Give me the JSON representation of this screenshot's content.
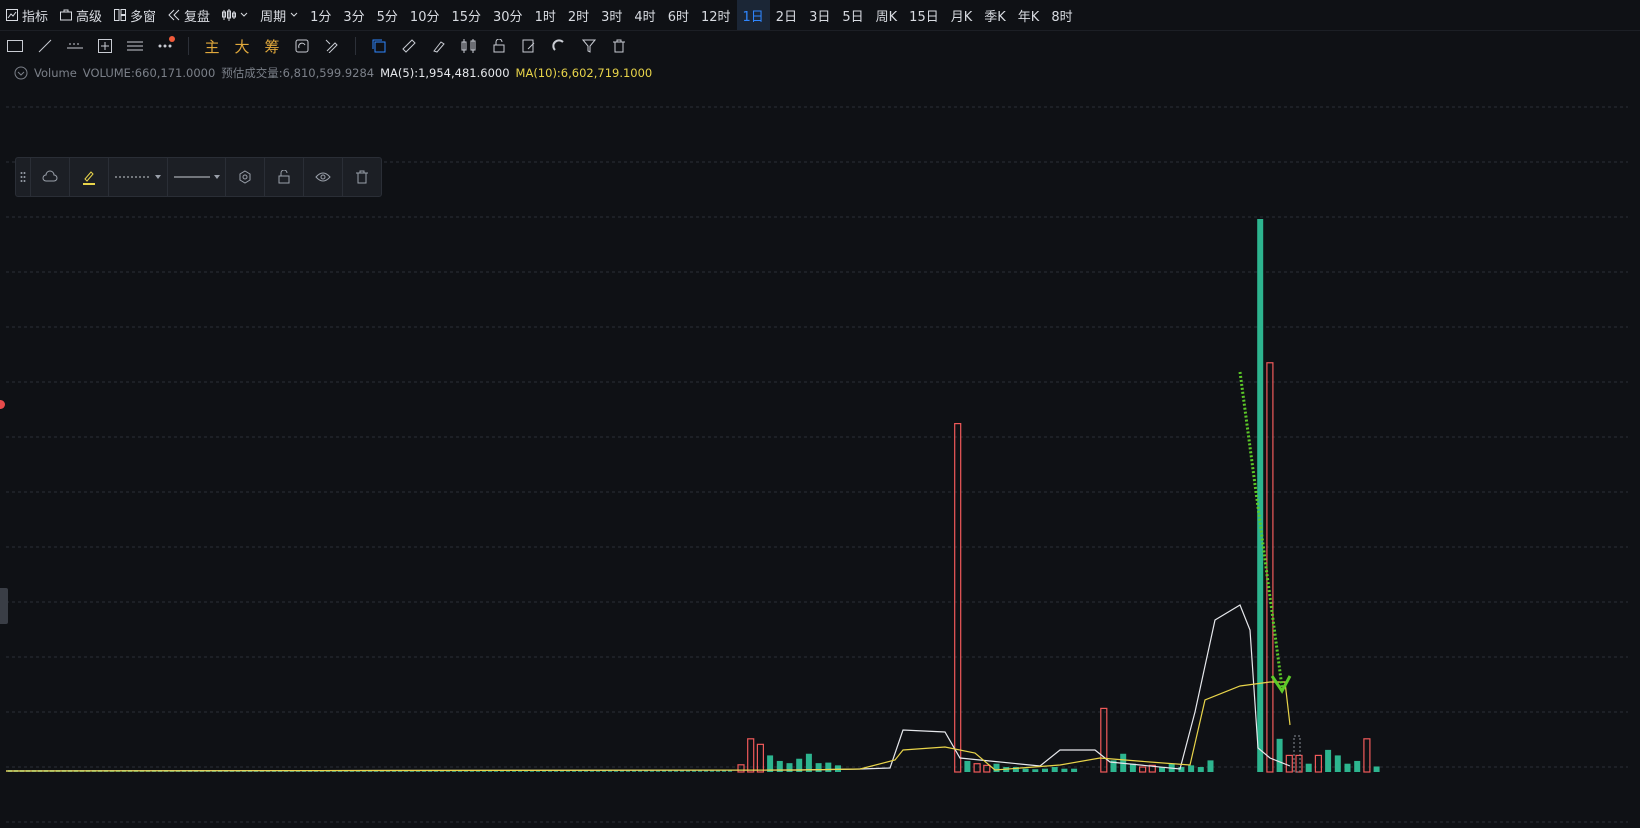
{
  "topbar": {
    "items": [
      "指标",
      "高级",
      "多窗",
      "复盘",
      "",
      "周期"
    ],
    "periods": [
      "1分",
      "3分",
      "5分",
      "10分",
      "15分",
      "30分",
      "1时",
      "2时",
      "3时",
      "4时",
      "6时",
      "12时",
      "1日",
      "2日",
      "3日",
      "5日",
      "周K",
      "15日",
      "月K",
      "季K",
      "年K",
      "8时"
    ],
    "active_period": "1日"
  },
  "toolbar": {
    "indicator_buttons": [
      "主",
      "大",
      "筹"
    ],
    "accent": "#e0a83c",
    "active_color": "#2f86ff"
  },
  "legend": {
    "name": "Volume",
    "volume": "VOLUME:660,171.0000",
    "estimated": "预估成交量:6,810,599.9284",
    "ma5": "MA(5):1,954,481.6000",
    "ma10": "MA(10):6,602,719.1000"
  },
  "colors": {
    "up": "#f05a5a",
    "down": "#2db58f",
    "ma5": "#e6e8ec",
    "ma10": "#e8d44a",
    "arrow": "#5cc928",
    "grid": "#2b2f36"
  },
  "chart_data": {
    "type": "bar",
    "title": "Volume",
    "series": [
      {
        "name": "VOLUME",
        "type": "bar"
      },
      {
        "name": "MA(5)",
        "type": "line"
      },
      {
        "name": "MA(10)",
        "type": "line"
      }
    ],
    "relative_volume": [
      [
        0.013,
        "up"
      ],
      [
        0.06,
        "up"
      ],
      [
        0.05,
        "up"
      ],
      [
        0.03,
        "down"
      ],
      [
        0.02,
        "down"
      ],
      [
        0.016,
        "down"
      ],
      [
        0.024,
        "down"
      ],
      [
        0.033,
        "down"
      ],
      [
        0.016,
        "down"
      ],
      [
        0.017,
        "down"
      ],
      [
        0.012,
        "down"
      ],
      [
        0.63,
        "up"
      ],
      [
        0.02,
        "down"
      ],
      [
        0.015,
        "up"
      ],
      [
        0.012,
        "up"
      ],
      [
        0.015,
        "down"
      ],
      [
        0.009,
        "down"
      ],
      [
        0.009,
        "down"
      ],
      [
        0.006,
        "down"
      ],
      [
        0.005,
        "down"
      ],
      [
        0.006,
        "down"
      ],
      [
        0.009,
        "down"
      ],
      [
        0.006,
        "down"
      ],
      [
        0.006,
        "down"
      ],
      [
        0.115,
        "up"
      ],
      [
        0.021,
        "down"
      ],
      [
        0.033,
        "down"
      ],
      [
        0.015,
        "down"
      ],
      [
        0.009,
        "up"
      ],
      [
        0.012,
        "up"
      ],
      [
        0.009,
        "down"
      ],
      [
        0.015,
        "down"
      ],
      [
        0.009,
        "down"
      ],
      [
        0.012,
        "down"
      ],
      [
        0.009,
        "down"
      ],
      [
        0.021,
        "down"
      ],
      [
        1.0,
        "down"
      ],
      [
        0.74,
        "up"
      ],
      [
        0.06,
        "down"
      ],
      [
        0.03,
        "up"
      ],
      [
        0.03,
        "up"
      ],
      [
        0.015,
        "down"
      ],
      [
        0.03,
        "up"
      ],
      [
        0.04,
        "down"
      ],
      [
        0.03,
        "down"
      ],
      [
        0.015,
        "down"
      ],
      [
        0.02,
        "down"
      ],
      [
        0.06,
        "up"
      ],
      [
        0.01,
        "down"
      ]
    ]
  }
}
